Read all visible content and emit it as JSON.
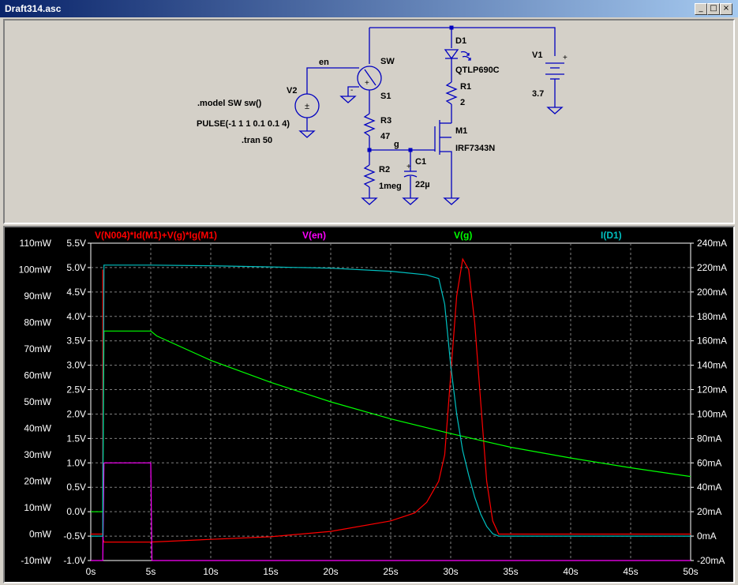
{
  "window": {
    "title": "Draft314.asc",
    "buttons": [
      "_",
      "□",
      "×"
    ]
  },
  "schematic": {
    "components": {
      "V2": {
        "ref": "V2"
      },
      "V1": {
        "ref": "V1",
        "value": "3.7"
      },
      "SW": {
        "ref": "SW",
        "model": "S1"
      },
      "D1": {
        "ref": "D1",
        "model": "QTLP690C"
      },
      "R1": {
        "ref": "R1",
        "value": "2"
      },
      "R3": {
        "ref": "R3",
        "value": "47"
      },
      "R2": {
        "ref": "R2",
        "value": "1meg"
      },
      "C1": {
        "ref": "C1",
        "value": "22µ"
      },
      "M1": {
        "ref": "M1",
        "model": "IRF7343N"
      }
    },
    "nets": {
      "en": "en",
      "g": "g"
    },
    "directives": [
      ".model SW sw()",
      "PULSE(-1 1 1 0.1 0.1 4)",
      ".tran 50"
    ]
  },
  "plot": {
    "colors": {
      "power": "#ff0000",
      "en": "#ff00ff",
      "g": "#00ff00",
      "id1": "#00c0c0",
      "grid": "#808080",
      "axis": "#ffffff"
    },
    "trace_labels": {
      "power": "V(N004)*Id(M1)+V(g)*Ig(M1)",
      "en": "V(en)",
      "g": "V(g)",
      "id1": "I(D1)"
    },
    "x_ticks": [
      "0s",
      "5s",
      "10s",
      "15s",
      "20s",
      "25s",
      "30s",
      "35s",
      "40s",
      "45s",
      "50s"
    ],
    "y_power_ticks": [
      "110mW",
      "100mW",
      "90mW",
      "80mW",
      "70mW",
      "60mW",
      "50mW",
      "40mW",
      "30mW",
      "20mW",
      "10mW",
      "0mW",
      "-10mW"
    ],
    "y_volt_ticks": [
      "5.5V",
      "5.0V",
      "4.5V",
      "4.0V",
      "3.5V",
      "3.0V",
      "2.5V",
      "2.0V",
      "1.5V",
      "1.0V",
      "0.5V",
      "0.0V",
      "-0.5V",
      "-1.0V"
    ],
    "y_current_ticks": [
      "240mA",
      "220mA",
      "200mA",
      "180mA",
      "160mA",
      "140mA",
      "120mA",
      "100mA",
      "80mA",
      "60mA",
      "40mA",
      "20mA",
      "0mA",
      "-20mA"
    ]
  },
  "chart_data": {
    "type": "line",
    "xlabel": "",
    "xlim": [
      0,
      50
    ],
    "axes": {
      "left_power_mW": [
        -10,
        110
      ],
      "left_voltage_V": [
        -1.0,
        5.5
      ],
      "right_current_mA": [
        -20,
        240
      ]
    },
    "grid": true,
    "series": [
      {
        "name": "V(N004)*Id(M1)+V(g)*Ig(M1)",
        "axis": "power_mW",
        "x": [
          0,
          1.0,
          1.0,
          1.01,
          1.1,
          5,
          10,
          15,
          20,
          25,
          27,
          28,
          29,
          29.5,
          30,
          30.5,
          31,
          31.5,
          32,
          32.5,
          33,
          33.5,
          34,
          35,
          40,
          45,
          50
        ],
        "y": [
          0,
          0,
          100,
          -2,
          -3,
          -3,
          -2,
          -1,
          1,
          5,
          8,
          12,
          20,
          30,
          60,
          90,
          104,
          100,
          80,
          50,
          20,
          5,
          0,
          0,
          0,
          0,
          0
        ]
      },
      {
        "name": "V(en)",
        "axis": "voltage_V",
        "x": [
          0,
          1.0,
          1.1,
          5.0,
          5.1,
          50
        ],
        "y": [
          -1,
          -1,
          1,
          1,
          -1,
          -1
        ]
      },
      {
        "name": "V(g)",
        "axis": "voltage_V",
        "x": [
          0,
          1.0,
          1.1,
          5,
          5.5,
          10,
          15,
          20,
          25,
          30,
          35,
          40,
          45,
          50
        ],
        "y": [
          0,
          0,
          3.7,
          3.7,
          3.6,
          3.1,
          2.65,
          2.25,
          1.9,
          1.6,
          1.32,
          1.1,
          0.9,
          0.72
        ]
      },
      {
        "name": "I(D1)",
        "axis": "current_mA",
        "x": [
          0,
          1.0,
          1.01,
          1.1,
          5,
          10,
          15,
          20,
          25,
          28,
          29,
          29.5,
          30,
          30.5,
          31,
          31.5,
          32,
          32.5,
          33,
          33.5,
          34,
          35,
          40,
          45,
          50
        ],
        "y": [
          0,
          0,
          60,
          222,
          222,
          221.5,
          220.5,
          219.5,
          217,
          214,
          211,
          190,
          140,
          100,
          70,
          50,
          32,
          18,
          8,
          2,
          0,
          0,
          0,
          0,
          0
        ]
      }
    ]
  }
}
